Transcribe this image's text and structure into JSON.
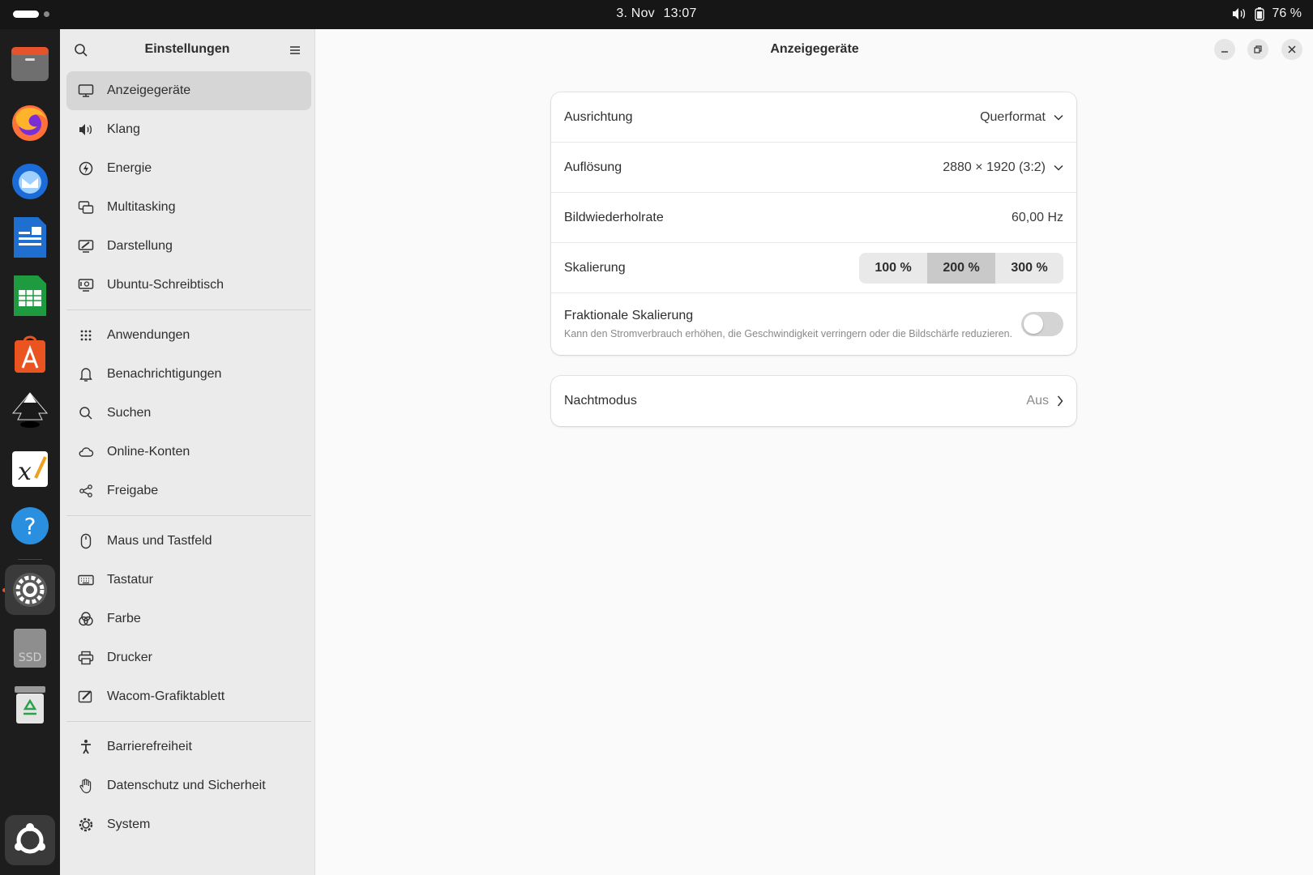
{
  "topbar": {
    "date": "3. Nov",
    "time": "13:07",
    "battery_percent": "76 %"
  },
  "dock": {
    "apps": [
      {
        "name": "files-icon"
      },
      {
        "name": "firefox-icon"
      },
      {
        "name": "thunderbird-icon"
      },
      {
        "name": "libreoffice-writer-icon"
      },
      {
        "name": "libreoffice-calc-icon"
      },
      {
        "name": "app-center-icon"
      },
      {
        "name": "inkscape-icon"
      },
      {
        "name": "xournal-icon"
      },
      {
        "name": "help-icon"
      },
      {
        "name": "settings-icon"
      },
      {
        "name": "ssd-drive-icon",
        "label": "SSD"
      },
      {
        "name": "trash-icon"
      },
      {
        "name": "show-apps-icon"
      }
    ]
  },
  "sidebar": {
    "title": "Einstellungen",
    "items": [
      {
        "label": "Anzeigegeräte",
        "icon": "display-icon",
        "selected": true
      },
      {
        "label": "Klang",
        "icon": "speaker-icon"
      },
      {
        "label": "Energie",
        "icon": "power-icon"
      },
      {
        "label": "Multitasking",
        "icon": "multitasking-icon"
      },
      {
        "label": "Darstellung",
        "icon": "appearance-icon"
      },
      {
        "label": "Ubuntu-Schreibtisch",
        "icon": "desktop-icon"
      },
      {
        "label": "Anwendungen",
        "icon": "apps-grid-icon"
      },
      {
        "label": "Benachrichtigungen",
        "icon": "bell-icon"
      },
      {
        "label": "Suchen",
        "icon": "search-icon"
      },
      {
        "label": "Online-Konten",
        "icon": "cloud-icon"
      },
      {
        "label": "Freigabe",
        "icon": "share-icon"
      },
      {
        "label": "Maus und Tastfeld",
        "icon": "mouse-icon"
      },
      {
        "label": "Tastatur",
        "icon": "keyboard-icon"
      },
      {
        "label": "Farbe",
        "icon": "color-icon"
      },
      {
        "label": "Drucker",
        "icon": "printer-icon"
      },
      {
        "label": "Wacom-Grafiktablett",
        "icon": "tablet-icon"
      },
      {
        "label": "Barrierefreiheit",
        "icon": "accessibility-icon"
      },
      {
        "label": "Datenschutz und Sicherheit",
        "icon": "hand-icon"
      },
      {
        "label": "System",
        "icon": "gear-icon"
      }
    ]
  },
  "content": {
    "title": "Anzeigegeräte",
    "orientation": {
      "label": "Ausrichtung",
      "value": "Querformat"
    },
    "resolution": {
      "label": "Auflösung",
      "value": "2880 × 1920 (3:2)"
    },
    "refresh_rate": {
      "label": "Bildwiederholrate",
      "value": "60,00 Hz"
    },
    "scaling": {
      "label": "Skalierung",
      "options": [
        "100 %",
        "200 %",
        "300 %"
      ],
      "selected": "200 %"
    },
    "fractional_scaling": {
      "label": "Fraktionale Skalierung",
      "description": "Kann den Stromverbrauch erhöhen, die Geschwindigkeit verringern oder die Bildschärfe reduzieren.",
      "enabled": false
    },
    "night_mode": {
      "label": "Nachtmodus",
      "value": "Aus"
    }
  }
}
